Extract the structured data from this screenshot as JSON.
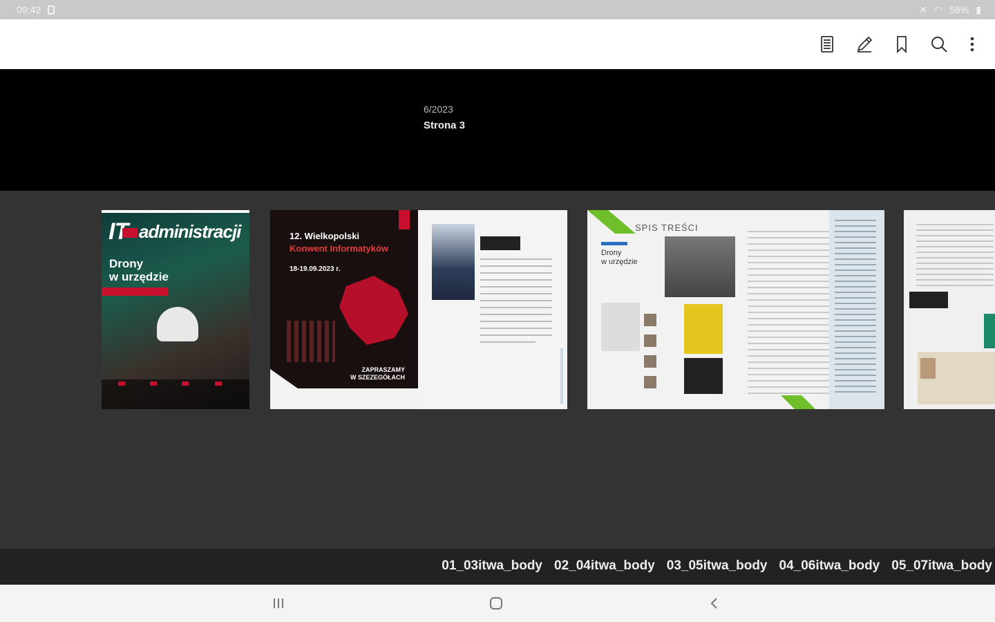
{
  "status_bar": {
    "time": "09:42",
    "battery": "58%"
  },
  "toolbar": {
    "icons": [
      "table-of-contents-icon",
      "pen-icon",
      "bookmark-icon",
      "search-icon",
      "more-vert-icon"
    ]
  },
  "tooltip": {
    "issue": "6/2023",
    "page": "Strona 3"
  },
  "thumbnails": {
    "cover": {
      "logo_it": "IT",
      "logo_title": "administracji",
      "headline": "Drony\nw urzędzie"
    },
    "spread1": {
      "title": "12. Wielkopolski",
      "subtitle": "Konwent Informatyków",
      "line": "18-19.09.2023 r.",
      "cta": "ZAPRASZAMY\nW SZEZEGÓŁACH"
    },
    "spread2": {
      "heading": "SPIS TREŚCI",
      "feature": "Drony\nw urzędzie"
    }
  },
  "chapters": [
    "01_03itwa_body",
    "02_04itwa_body",
    "03_05itwa_body",
    "04_06itwa_body",
    "05_07itwa_body"
  ],
  "colors": {
    "accent_red": "#c8102e",
    "accent_green": "#6fbf2a",
    "dark_bg": "#000000",
    "strip_bg": "#333333"
  }
}
